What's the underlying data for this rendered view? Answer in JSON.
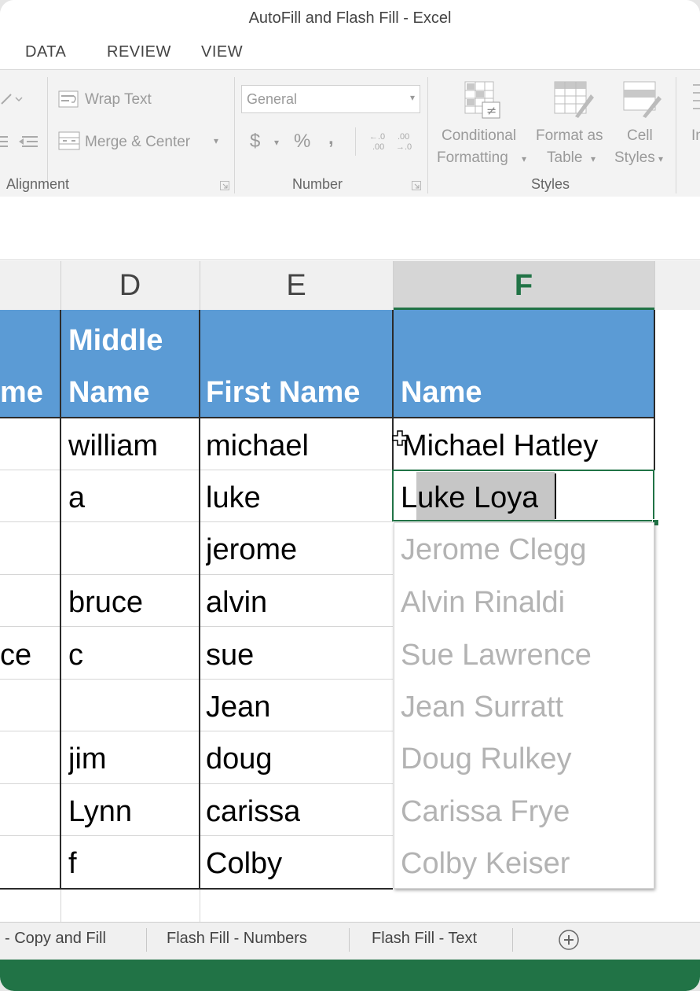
{
  "window": {
    "title": "AutoFill and Flash Fill - Excel"
  },
  "ribbon_tabs": [
    "DATA",
    "REVIEW",
    "VIEW"
  ],
  "ribbon": {
    "wrap_text": "Wrap Text",
    "merge_center": "Merge & Center",
    "alignment_label": "Alignment",
    "number_format": "General",
    "currency": "$",
    "percent": "%",
    "comma": ",",
    "number_label": "Number",
    "conditional_formatting": [
      "Conditional",
      "Formatting"
    ],
    "format_as_table": [
      "Format as",
      "Table"
    ],
    "cell_styles": [
      "Cell",
      "Styles"
    ],
    "insert_partial": "In",
    "styles_label": "Styles"
  },
  "columns": [
    "D",
    "E",
    "F"
  ],
  "header_row": {
    "c_partial": "me",
    "d": [
      "Middle",
      "Name"
    ],
    "e": "First Name",
    "f": "Name"
  },
  "rows": [
    {
      "c": "",
      "d": "william",
      "e": "michael",
      "f": "Michael Hatley"
    },
    {
      "c": "",
      "d": "a",
      "e": "luke",
      "f": "Luke Loya"
    },
    {
      "c": "",
      "d": "",
      "e": "jerome",
      "f": ""
    },
    {
      "c": "",
      "d": "bruce",
      "e": "alvin",
      "f": ""
    },
    {
      "c": "ce",
      "d": "c",
      "e": "sue",
      "f": ""
    },
    {
      "c": "",
      "d": "",
      "e": "Jean",
      "f": ""
    },
    {
      "c": "",
      "d": "jim",
      "e": "doug",
      "f": ""
    },
    {
      "c": "",
      "d": "Lynn",
      "e": "carissa",
      "f": ""
    },
    {
      "c": "",
      "d": "f",
      "e": "Colby",
      "f": ""
    }
  ],
  "flash_fill_suggestions": [
    "Jerome Clegg",
    "Alvin Rinaldi",
    "Sue Lawrence",
    "Jean Surratt",
    "Doug Rulkey",
    "Carissa Frye",
    "Colby Keiser"
  ],
  "sheet_tabs": [
    "- Copy and Fill",
    "Flash Fill - Numbers",
    "Flash Fill - Text"
  ],
  "colors": {
    "accent": "#217346",
    "header_fill": "#5b9bd5",
    "ghost_text": "#b3b3b3"
  }
}
